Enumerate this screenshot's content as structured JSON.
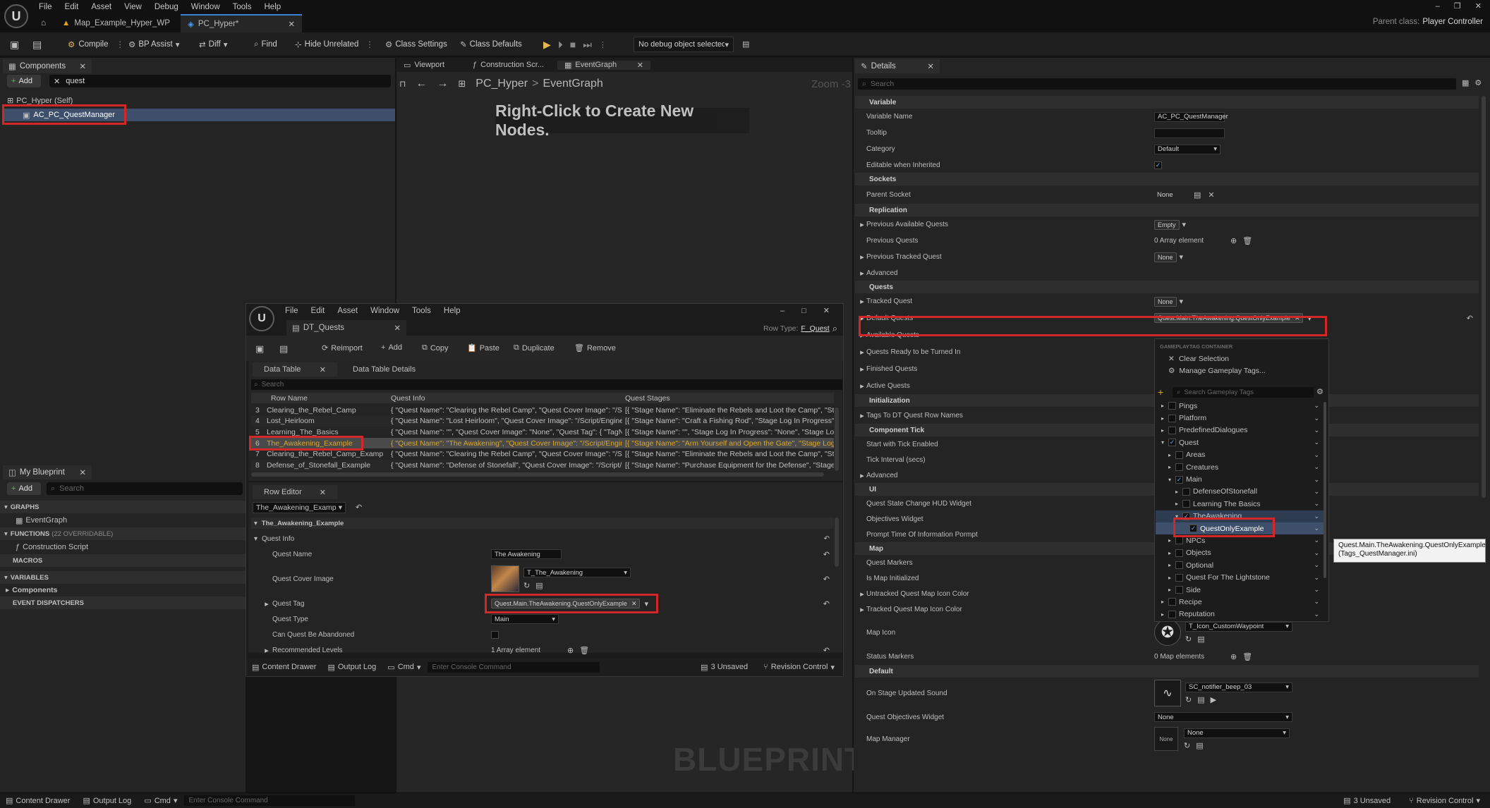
{
  "app": {
    "menu": [
      "File",
      "Edit",
      "Asset",
      "View",
      "Debug",
      "Window",
      "Tools",
      "Help"
    ],
    "tabs": [
      {
        "label": "Map_Example_Hyper_WP"
      },
      {
        "label": "PC_Hyper*"
      }
    ],
    "parent_class": "Parent class:",
    "parent_class_value": "Player Controller"
  },
  "toolbar": {
    "compile": "Compile",
    "bp_assist": "BP Assist",
    "diff": "Diff",
    "find": "Find",
    "hide_unrelated": "Hide Unrelated",
    "class_settings": "Class Settings",
    "class_defaults": "Class Defaults",
    "debug_object": "No debug object selected"
  },
  "components": {
    "tab": "Components",
    "add": "Add",
    "search_value": "quest",
    "root": "PC_Hyper (Self)",
    "item": "AC_PC_QuestManager"
  },
  "graph": {
    "tabs": [
      "Viewport",
      "Construction Scr...",
      "EventGraph"
    ],
    "breadcrumb_root": "PC_Hyper",
    "breadcrumb_sep": ">",
    "breadcrumb_leaf": "EventGraph",
    "zoom": "Zoom -3",
    "hint": "Right-Click to Create New Nodes.",
    "watermark": "BLUEPRINT"
  },
  "my_blueprint": {
    "tab": "My Blueprint",
    "add": "Add",
    "search_placeholder": "Search",
    "sections": {
      "graphs": "GRAPHS",
      "event_graph": "EventGraph",
      "functions": "FUNCTIONS",
      "functions_count": "(22 OVERRIDABLE)",
      "construction_script": "Construction Script",
      "macros": "MACROS",
      "variables": "VARIABLES",
      "components": "Components",
      "event_dispatchers": "EVENT DISPATCHERS"
    }
  },
  "dt": {
    "menu": [
      "File",
      "Edit",
      "Asset",
      "Window",
      "Tools",
      "Help"
    ],
    "tab": "DT_Quests",
    "reimport": "Reimport",
    "add": "Add",
    "copy": "Copy",
    "paste": "Paste",
    "duplicate": "Duplicate",
    "remove": "Remove",
    "row_type_label": "Row Type:",
    "row_type_value": "F_Quest",
    "subtabs": [
      "Data Table",
      "Data Table Details"
    ],
    "search_placeholder": "Search",
    "columns": [
      "Row Name",
      "Quest Info",
      "Quest Stages"
    ],
    "rows": [
      {
        "n": "3",
        "name": "Clearing_the_Rebel_Camp",
        "info": "{ \"Quest Name\": \"Clearing the Rebel Camp\", \"Quest Cover Image\": \"/Script/",
        "stages": "[{ \"Stage Name\": \"Eliminate the Rebels and Loot the Camp\", \"Stage L"
      },
      {
        "n": "4",
        "name": "Lost_Heirloom",
        "info": "{ \"Quest Name\": \"Lost Heirloom\", \"Quest Cover Image\": \"/Script/Engine.Tex",
        "stages": "[{ \"Stage Name\": \"Craft a Fishing Rod\", \"Stage Log In Progress\": \"The"
      },
      {
        "n": "5",
        "name": "Learning_The_Basics",
        "info": "{ \"Quest Name\": \"\", \"Quest Cover Image\": \"None\", \"Quest Tag\": { \"TagName\"",
        "stages": "[{ \"Stage Name\": \"\", \"Stage Log In Progress\": \"None\", \"Stage Log Com"
      },
      {
        "n": "6",
        "name": "The_Awakening_Example",
        "info": "{ \"Quest Name\": \"The Awakening\", \"Quest Cover Image\": \"/Script/Engine.Te",
        "stages": "[{ \"Stage Name\": \"Arm Yourself and Open the Gate\", \"Stage Log In Pr"
      },
      {
        "n": "7",
        "name": "Clearing_the_Rebel_Camp_Examp",
        "info": "{ \"Quest Name\": \"Clearing the Rebel Camp\", \"Quest Cover Image\": \"/Script/",
        "stages": "[{ \"Stage Name\": \"Eliminate the Rebels and Loot the Camp\", \"Stage L"
      },
      {
        "n": "8",
        "name": "Defense_of_Stonefall_Example",
        "info": "{ \"Quest Name\": \"Defense of Stonefall\", \"Quest Cover Image\": \"/Script/Engi",
        "stages": "[{ \"Stage Name\": \"Purchase Equipment for the Defense\", \"Stage Log"
      }
    ],
    "row_editor_tab": "Row Editor",
    "row_select": "The_Awakening_Examp",
    "struct_name": "The_Awakening_Example",
    "quest_info": "Quest Info",
    "quest_name_label": "Quest Name",
    "quest_name_value": "The Awakening",
    "cover_label": "Quest Cover Image",
    "cover_value": "T_The_Awakening",
    "tag_label": "Quest Tag",
    "tag_value": "Quest.Main.TheAwakening.QuestOnlyExample",
    "type_label": "Quest Type",
    "type_value": "Main",
    "abandon_label": "Can Quest Be Abandoned",
    "levels_label": "Recommended Levels",
    "levels_value": "1 Array element",
    "bottom": {
      "content_drawer": "Content Drawer",
      "output_log": "Output Log",
      "cmd": "Cmd",
      "console_placeholder": "Enter Console Command",
      "unsaved": "3 Unsaved",
      "revision": "Revision Control"
    }
  },
  "details": {
    "tab": "Details",
    "search_placeholder": "Search",
    "sec_variable": "Variable",
    "variable_name_label": "Variable Name",
    "variable_name_value": "AC_PC_QuestManager",
    "tooltip_label": "Tooltip",
    "category_label": "Category",
    "category_value": "Default",
    "editable_label": "Editable when Inherited",
    "sec_sockets": "Sockets",
    "parent_socket_label": "Parent Socket",
    "parent_socket_value": "None",
    "sec_replication": "Replication",
    "prev_available_label": "Previous Available Quests",
    "prev_available_value": "Empty",
    "prev_quests_label": "Previous Quests",
    "prev_quests_value": "0 Array element",
    "prev_tracked_label": "Previous Tracked Quest",
    "prev_tracked_value": "None",
    "advanced": "Advanced",
    "sec_quests": "Quests",
    "tracked_quest_label": "Tracked Quest",
    "tracked_quest_value": "None",
    "default_quests_label": "Default Quests",
    "default_quests_value": "Quest.Main.TheAwakening.QuestOnlyExample",
    "available_label": "Available Quests",
    "ready_label": "Quests Ready to be Turned In",
    "finished_label": "Finished Quests",
    "active_label": "Active Quests",
    "sec_init": "Initialization",
    "tags_to_dt_label": "Tags To DT Quest Row Names",
    "sec_tick": "Component Tick",
    "start_tick_label": "Start with Tick Enabled",
    "tick_interval_label": "Tick Interval (secs)",
    "sec_ui": "UI",
    "hud_widget_label": "Quest State Change HUD Widget",
    "obj_widget_label": "Objectives Widget",
    "prompt_label": "Prompt Time Of Information Pormpt",
    "sec_map": "Map",
    "markers_label": "Quest Markers",
    "map_init_label": "Is Map Initialized",
    "untracked_color_label": "Untracked Quest Map Icon Color",
    "tracked_color_label": "Tracked Quest Map Icon Color",
    "map_icon_label": "Map Icon",
    "map_icon_value": "T_Icon_CustomWaypoint",
    "status_markers_label": "Status Markers",
    "status_markers_value": "0 Map elements",
    "sec_default": "Default",
    "stage_sound_label": "On Stage Updated Sound",
    "stage_sound_value": "SC_notifier_beep_03",
    "qo_widget_label": "Quest Objectives Widget",
    "qo_widget_value": "None",
    "map_manager_label": "Map Manager",
    "map_manager_value": "None",
    "map_manager_thumb": "None"
  },
  "tag_picker": {
    "header": "GAMEPLAYTAG CONTAINER",
    "clear": "Clear Selection",
    "manage": "Manage Gameplay Tags...",
    "search_placeholder": "Search Gameplay Tags",
    "items": [
      {
        "label": "Pings",
        "indent": 0,
        "checked": false
      },
      {
        "label": "Platform",
        "indent": 0,
        "checked": false
      },
      {
        "label": "PredefinedDialogues",
        "indent": 0,
        "checked": false
      },
      {
        "label": "Quest",
        "indent": 0,
        "checked": true
      },
      {
        "label": "Areas",
        "indent": 1,
        "checked": false
      },
      {
        "label": "Creatures",
        "indent": 1,
        "checked": false
      },
      {
        "label": "Main",
        "indent": 1,
        "checked": true
      },
      {
        "label": "DefenseOfStonefall",
        "indent": 2,
        "checked": false
      },
      {
        "label": "Learning The Basics",
        "indent": 2,
        "checked": false
      },
      {
        "label": "TheAwakening",
        "indent": 2,
        "checked": true
      },
      {
        "label": "QuestOnlyExample",
        "indent": 3,
        "checked": true
      },
      {
        "label": "NPCs",
        "indent": 1,
        "checked": false
      },
      {
        "label": "Objects",
        "indent": 1,
        "checked": false
      },
      {
        "label": "Optional",
        "indent": 1,
        "checked": false
      },
      {
        "label": "Quest For The Lightstone",
        "indent": 1,
        "checked": false
      },
      {
        "label": "Side",
        "indent": 1,
        "checked": false
      },
      {
        "label": "Recipe",
        "indent": 0,
        "checked": false
      },
      {
        "label": "Reputation",
        "indent": 0,
        "checked": false
      }
    ],
    "tooltip_line1": "Quest.Main.TheAwakening.QuestOnlyExample",
    "tooltip_line2": "(Tags_QuestManager.ini)"
  },
  "statusbar": {
    "content_drawer": "Content Drawer",
    "output_log": "Output Log",
    "cmd": "Cmd",
    "console_placeholder": "Enter Console Command",
    "unsaved": "3 Unsaved",
    "revision": "Revision Control"
  },
  "colors": {
    "accent": "#d42828",
    "selection": "#3d4f6b",
    "highlight_row": "#d9a72a",
    "tracked_color": "#b9a16a"
  }
}
